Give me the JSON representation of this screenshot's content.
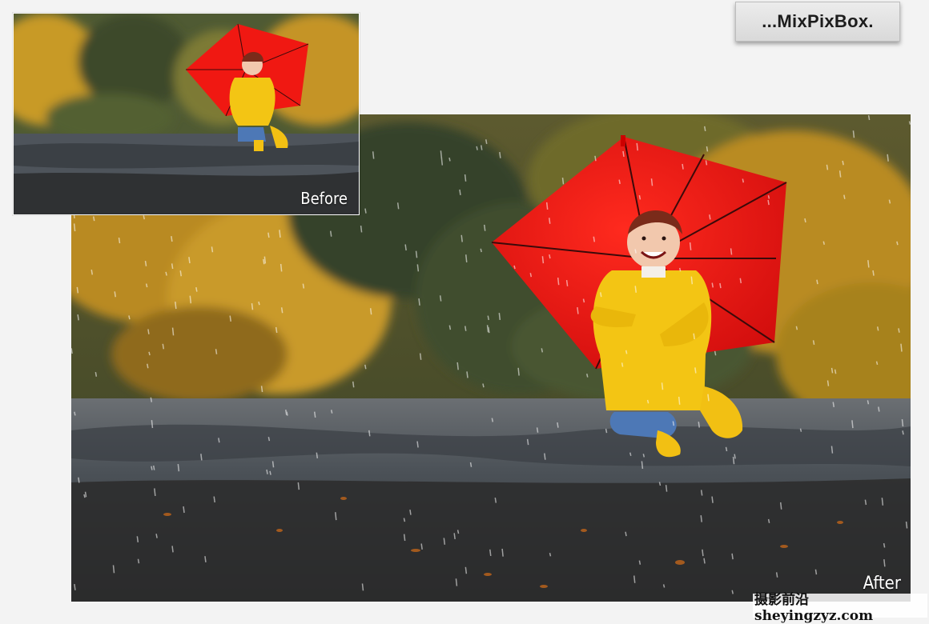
{
  "logo": {
    "text": "...MixPixBox."
  },
  "after": {
    "label": "After"
  },
  "before": {
    "label": "Before"
  },
  "watermark": {
    "text": "摄影前沿 sheyingzyz.com"
  },
  "colors": {
    "umbrella": "#f01212",
    "raincoat": "#f2c20a",
    "foliage_gold": "#c89522",
    "foliage_green": "#3d4a2c",
    "pavement": "#5c6269"
  }
}
